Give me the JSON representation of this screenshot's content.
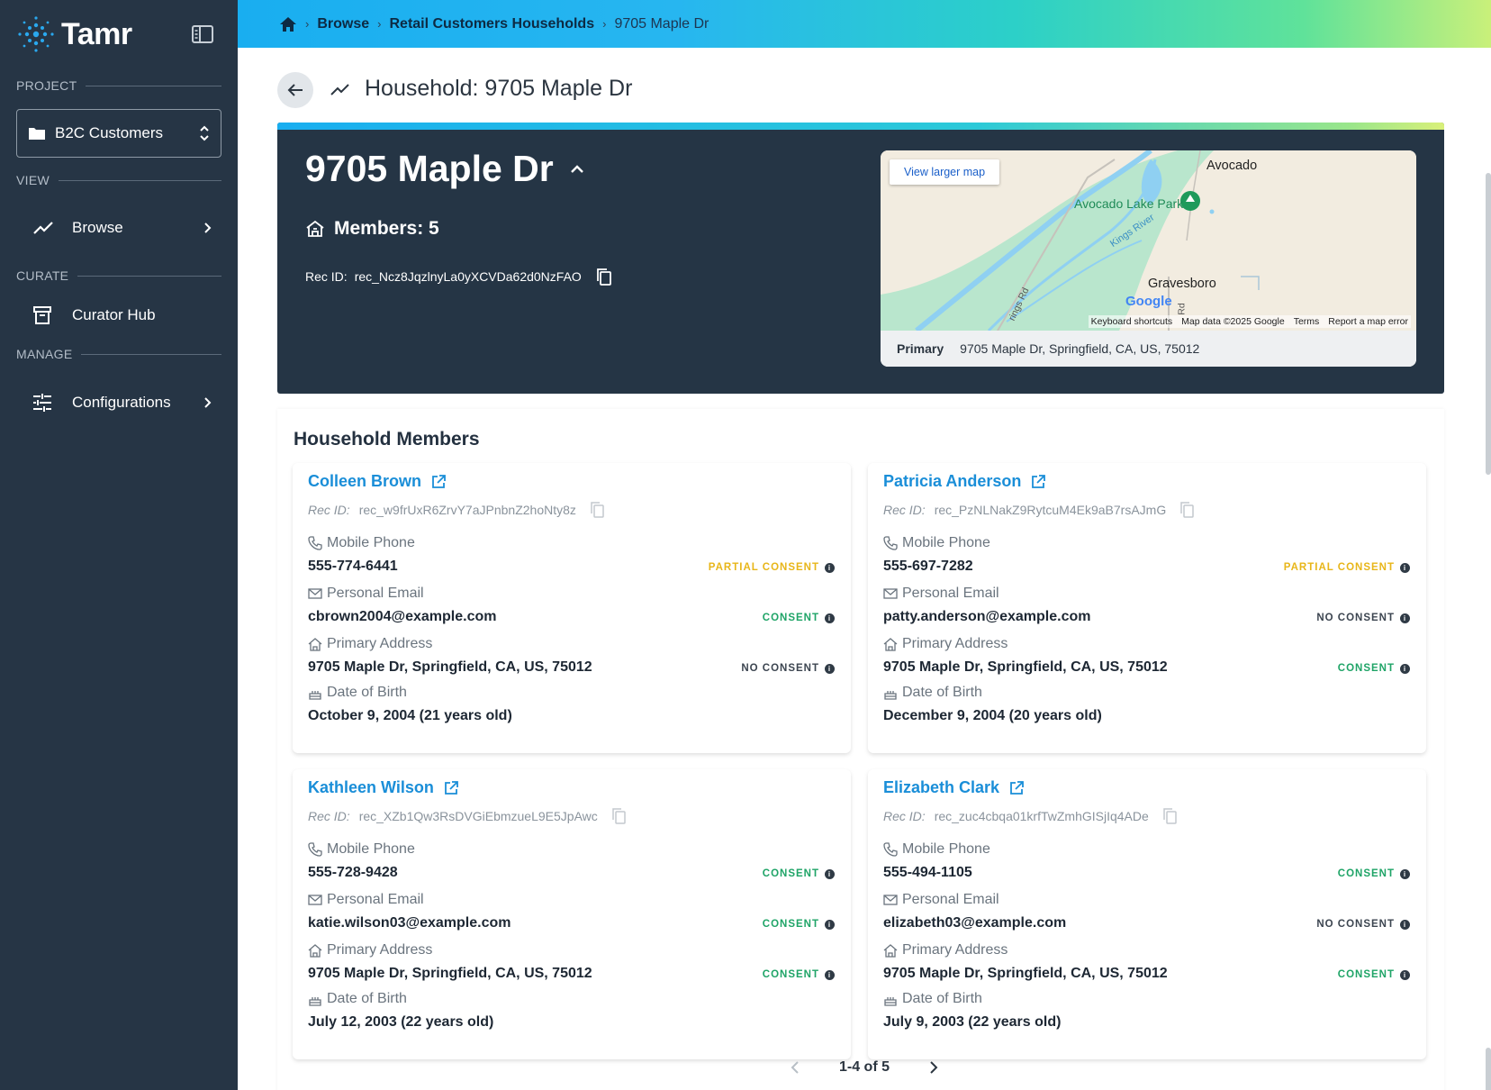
{
  "app": {
    "logo_text": "Tamr"
  },
  "sidebar": {
    "project_label": "PROJECT",
    "project_value": "B2C Customers",
    "view_label": "VIEW",
    "browse_label": "Browse",
    "curate_label": "CURATE",
    "curator_label": "Curator Hub",
    "manage_label": "MANAGE",
    "config_label": "Configurations"
  },
  "breadcrumb": {
    "browse": "Browse",
    "dataset": "Retail Customers Households",
    "current": "9705 Maple Dr"
  },
  "page": {
    "title": "Household: 9705 Maple Dr"
  },
  "hero": {
    "name": "9705 Maple Dr",
    "members": "Members: 5",
    "rec_label": "Rec ID:",
    "rec_id": "rec_Ncz8JqzlnyLa0yXCVDa62d0NzFAO"
  },
  "map": {
    "view_larger": "View larger map",
    "place_avocado": "Avocado",
    "place_park": "Avocado Lake Park",
    "place_river": "Kings River",
    "place_gravesboro": "Gravesboro",
    "road_1": "Rd",
    "road_2": "rings Rd",
    "google": "Google",
    "attrib_shortcuts": "Keyboard shortcuts",
    "attrib_data": "Map data ©2025 Google",
    "attrib_terms": "Terms",
    "attrib_report": "Report a map error",
    "primary_label": "Primary",
    "primary_value": "9705 Maple Dr, Springfield, CA, US, 75012"
  },
  "members": {
    "title": "Household Members",
    "field_labels": {
      "phone": "Mobile Phone",
      "email": "Personal Email",
      "address": "Primary Address",
      "dob": "Date of Birth"
    },
    "rec_label": "Rec ID:",
    "cards": [
      {
        "name": "Colleen Brown",
        "rec_id": "rec_w9frUxR6ZrvY7aJPnbnZ2hoNty8z",
        "phone": "555-774-6441",
        "phone_consent": "PARTIAL CONSENT",
        "email": "cbrown2004@example.com",
        "email_consent": "CONSENT",
        "address": "9705 Maple Dr, Springfield, CA, US, 75012",
        "address_consent": "NO CONSENT",
        "dob": "October 9, 2004 (21 years old)"
      },
      {
        "name": "Patricia Anderson",
        "rec_id": "rec_PzNLNakZ9RytcuM4Ek9aB7rsAJmG",
        "phone": "555-697-7282",
        "phone_consent": "PARTIAL CONSENT",
        "email": "patty.anderson@example.com",
        "email_consent": "NO CONSENT",
        "address": "9705 Maple Dr, Springfield, CA, US, 75012",
        "address_consent": "CONSENT",
        "dob": "December 9, 2004 (20 years old)"
      },
      {
        "name": "Kathleen Wilson",
        "rec_id": "rec_XZb1Qw3RsDVGiEbmzueL9E5JpAwc",
        "phone": "555-728-9428",
        "phone_consent": "CONSENT",
        "email": "katie.wilson03@example.com",
        "email_consent": "CONSENT",
        "address": "9705 Maple Dr, Springfield, CA, US, 75012",
        "address_consent": "CONSENT",
        "dob": "July 12, 2003 (22 years old)"
      },
      {
        "name": "Elizabeth Clark",
        "rec_id": "rec_zuc4cbqa01krfTwZmhGISjIq4ADe",
        "phone": "555-494-1105",
        "phone_consent": "CONSENT",
        "email": "elizabeth03@example.com",
        "email_consent": "NO CONSENT",
        "address": "9705 Maple Dr, Springfield, CA, US, 75012",
        "address_consent": "CONSENT",
        "dob": "July 9, 2003 (22 years old)"
      }
    ],
    "pagination": "1-4 of 5"
  }
}
